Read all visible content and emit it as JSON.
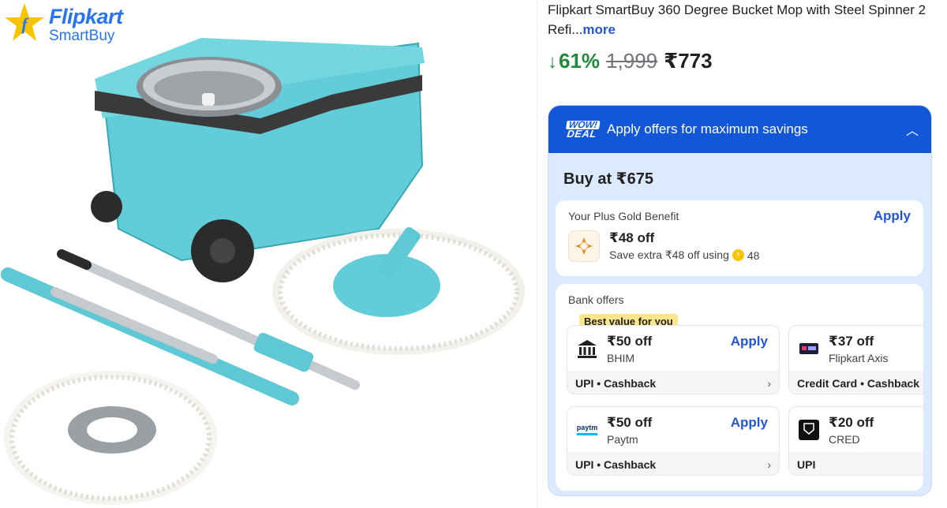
{
  "logo": {
    "brand": "Flipkart",
    "sub": "SmartBuy"
  },
  "product": {
    "title": "Flipkart SmartBuy 360 Degree Bucket Mop with Steel Spinner 2 Refi",
    "ellipsis": "...",
    "more": "more",
    "discount": "61%",
    "mrp": "1,999",
    "price": "₹773",
    "image_alt": "Bucket mop with steel spinner, two handles and two refill mop heads"
  },
  "offers": {
    "header_title": "Apply offers for maximum savings",
    "wow_line1": "WOW!",
    "wow_line2": "DEAL",
    "buy_at": "Buy at ₹675",
    "gold": {
      "title": "Your Plus Gold Benefit",
      "apply": "Apply",
      "amount": "₹48 off",
      "sub": "Save extra ₹48 off using",
      "coins": "48"
    },
    "bank": {
      "title": "Bank offers",
      "best_value": "Best value for you",
      "items": [
        {
          "amount": "₹50 off",
          "name": "BHIM",
          "apply": "Apply",
          "footer": "UPI • Cashback"
        },
        {
          "amount": "₹37 off",
          "name": "Flipkart Axis",
          "apply": "",
          "footer": "Credit Card • Cashback"
        },
        {
          "amount": "₹50 off",
          "name": "Paytm",
          "apply": "Apply",
          "footer": "UPI • Cashback"
        },
        {
          "amount": "₹20 off",
          "name": "CRED",
          "apply": "",
          "footer": "UPI"
        }
      ]
    }
  },
  "colors": {
    "accent": "#2455d4",
    "header_blue": "#1257d8",
    "discount_green": "#1f8a3c",
    "mop_teal": "#5ec9d4"
  }
}
